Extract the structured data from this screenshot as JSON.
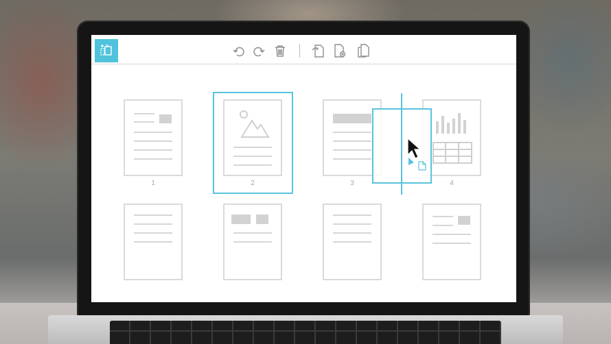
{
  "toolbar": {
    "logo_icon": "page-manager-logo-icon",
    "buttons": [
      {
        "name": "undo-icon"
      },
      {
        "name": "redo-icon"
      },
      {
        "name": "trash-icon"
      },
      {
        "name": "rotate-page-icon"
      },
      {
        "name": "delete-page-icon"
      },
      {
        "name": "duplicate-page-icon"
      }
    ]
  },
  "pages": [
    {
      "label": "1",
      "selected": false
    },
    {
      "label": "2",
      "selected": true
    },
    {
      "label": "3",
      "selected": false
    },
    {
      "label": "4",
      "selected": false
    }
  ],
  "colors": {
    "accent": "#58c3dc",
    "logo_bg": "#4fc3dc",
    "thumb_border": "#dadada",
    "thumb_content": "#d2d2d2"
  },
  "cursor": {
    "icon": "mouse-pointer-icon",
    "drag_badge_icon": "document-icon"
  }
}
